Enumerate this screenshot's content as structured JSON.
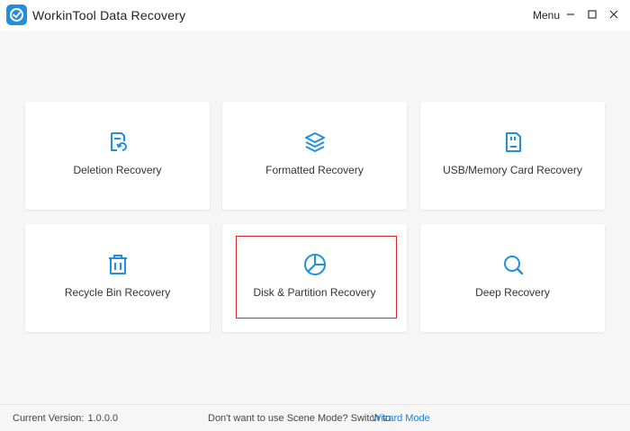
{
  "app": {
    "title": "WorkinTool Data Recovery",
    "logo_icon": "app-logo-icon",
    "accent_color": "#1f8fe0"
  },
  "titlebar": {
    "menu_label": "Menu",
    "minimize_icon": "minimize-icon",
    "maximize_icon": "maximize-icon",
    "close_icon": "close-icon"
  },
  "scenes": [
    {
      "label": "Deletion Recovery",
      "icon": "deletion-recovery-icon"
    },
    {
      "label": "Formatted Recovery",
      "icon": "layers-icon"
    },
    {
      "label": "USB/Memory Card Recovery",
      "icon": "memory-card-icon"
    },
    {
      "label": "Recycle Bin Recovery",
      "icon": "trash-icon"
    },
    {
      "label": "Disk & Partition Recovery",
      "icon": "pie-chart-icon",
      "highlighted": true
    },
    {
      "label": "Deep Recovery",
      "icon": "search-icon"
    }
  ],
  "footer": {
    "version_label": "Current Version:",
    "version_value": "1.0.0.0",
    "switch_text": "Don't want to use Scene Mode? Switch to",
    "wizard_link": "Wizard Mode"
  },
  "colors": {
    "icon_blue": "#1f8fe0",
    "highlight_red": "#e02424",
    "link_blue": "#1f7fd6"
  }
}
